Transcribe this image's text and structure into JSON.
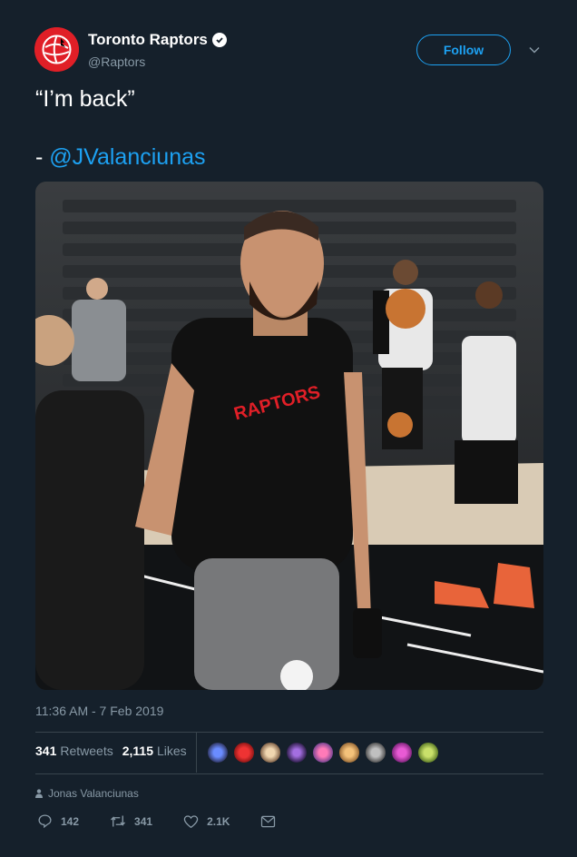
{
  "account": {
    "display_name": "Toronto Raptors",
    "handle": "@Raptors",
    "verified": true,
    "avatar_icon": "raptors-logo-icon"
  },
  "follow_button": {
    "label": "Follow"
  },
  "tweet": {
    "text_line1": "“I’m back”",
    "text_prefix": "- ",
    "mention": "@JValanciunas",
    "photo_description_icon": "photo"
  },
  "timestamp": "11:36 AM - 7 Feb 2019",
  "stats": {
    "retweets_count": "341",
    "retweets_label": "Retweets",
    "likes_count": "2,115",
    "likes_label": "Likes"
  },
  "tagged_user": "Jonas Valanciunas",
  "actions": {
    "reply_count": "142",
    "retweet_count": "341",
    "like_count": "2.1K"
  },
  "colors": {
    "background": "#15202b",
    "accent": "#1da1f2",
    "muted": "#8899a6",
    "brand_red": "#e01f27"
  }
}
